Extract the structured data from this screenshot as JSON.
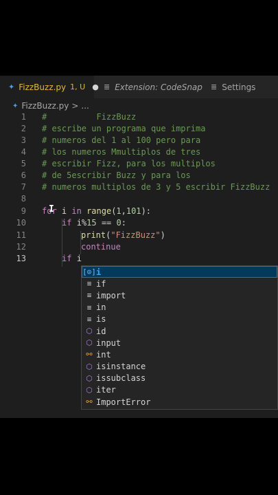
{
  "tabs": [
    {
      "label": "FizzBuzz.py",
      "status": "1, U",
      "dirty_marker": "●",
      "icon": "python-icon"
    },
    {
      "label": "Extension: CodeSnap",
      "icon": "extension-icon"
    },
    {
      "label": "Settings",
      "icon": "settings-icon"
    }
  ],
  "breadcrumb": {
    "file": "FizzBuzz.py",
    "sep": ">",
    "rest": "..."
  },
  "line_numbers": [
    "1",
    "2",
    "3",
    "4",
    "5",
    "6",
    "7",
    "8",
    "9",
    "10",
    "11",
    "12",
    "13"
  ],
  "code": {
    "l1": "#          FizzBuzz",
    "l2": "# escribe un programa que imprima",
    "l3": "# numeros del 1 al 100 pero para",
    "l4": "# los numeros Mmultiplos de tres",
    "l5": "# escribir Fizz, para los multiplos",
    "l6": "# de 5escribir Buzz y para los",
    "l7": "# numeros multiplos de 3 y 5 escribir FizzBuzz",
    "l9": {
      "kw1": "for",
      "rest1": " i ",
      "kw2": "in",
      "sp": " ",
      "fn": "range",
      "p1": "(",
      "n1": "1",
      "comma": ",",
      "n2": "101",
      "p2": "):"
    },
    "l10": {
      "kw": "if",
      "sp": " ",
      "v": "i",
      "op": "%",
      "n1": "15",
      "eq": " == ",
      "n2": "0",
      "colon": ":"
    },
    "l11": {
      "fn": "print",
      "p1": "(",
      "s": "\"FizzBuzz\"",
      "p2": ")"
    },
    "l12": {
      "kw": "continue"
    },
    "l13": {
      "kw": "if",
      "sp": " ",
      "v": "i"
    }
  },
  "suggestions": [
    {
      "label": "i",
      "kind": "variable",
      "icon": "variable-icon",
      "glyph": "[⊙]",
      "selected": true
    },
    {
      "label": "if",
      "kind": "keyword",
      "icon": "keyword-icon",
      "glyph": "≡"
    },
    {
      "label": "import",
      "kind": "keyword",
      "icon": "keyword-icon",
      "glyph": "≡"
    },
    {
      "label": "in",
      "kind": "keyword",
      "icon": "keyword-icon",
      "glyph": "≡"
    },
    {
      "label": "is",
      "kind": "keyword",
      "icon": "keyword-icon",
      "glyph": "≡"
    },
    {
      "label": "id",
      "kind": "function",
      "icon": "method-cube-icon",
      "glyph": "⬡"
    },
    {
      "label": "input",
      "kind": "function",
      "icon": "method-cube-icon",
      "glyph": "⬡"
    },
    {
      "label": "int",
      "kind": "class",
      "icon": "class-icon",
      "glyph": "⚯"
    },
    {
      "label": "isinstance",
      "kind": "function",
      "icon": "method-cube-icon",
      "glyph": "⬡"
    },
    {
      "label": "issubclass",
      "kind": "function",
      "icon": "method-cube-icon",
      "glyph": "⬡"
    },
    {
      "label": "iter",
      "kind": "function",
      "icon": "method-cube-icon",
      "glyph": "⬡"
    },
    {
      "label": "ImportError",
      "kind": "class",
      "icon": "class-icon",
      "glyph": "⚯"
    }
  ],
  "colors": {
    "editor_bg": "#1e1e1e",
    "comment": "#6a9955",
    "keyword": "#c586c0",
    "function": "#dcdcaa",
    "string": "#ce9178",
    "number": "#b5cea8",
    "modified": "#e2b93d",
    "match": "#2aaaff"
  }
}
